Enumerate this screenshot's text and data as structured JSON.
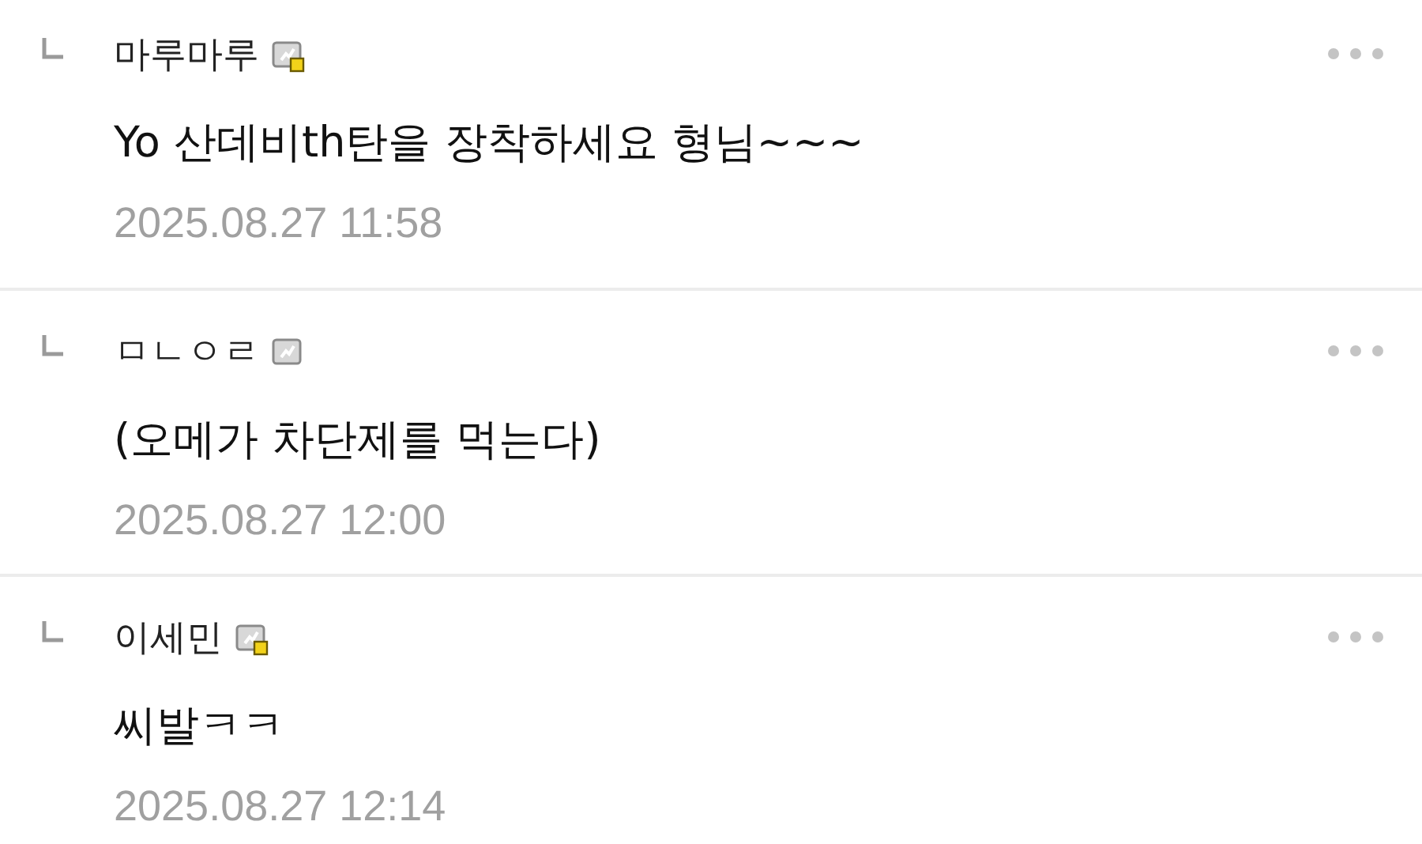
{
  "comments": [
    {
      "author": "마루마루",
      "fixed_nick": true,
      "text": "Yo 산데비th탄을 장착하세요 형님~~~",
      "date": "2025.08.27 11:58"
    },
    {
      "author": "ㅁㄴㅇㄹ",
      "fixed_nick": false,
      "text": "(오메가 차단제를 먹는다)",
      "date": "2025.08.27 12:00"
    },
    {
      "author": "이세민",
      "fixed_nick": true,
      "text": "씨발ㅋㅋ",
      "date": "2025.08.27 12:14"
    }
  ]
}
